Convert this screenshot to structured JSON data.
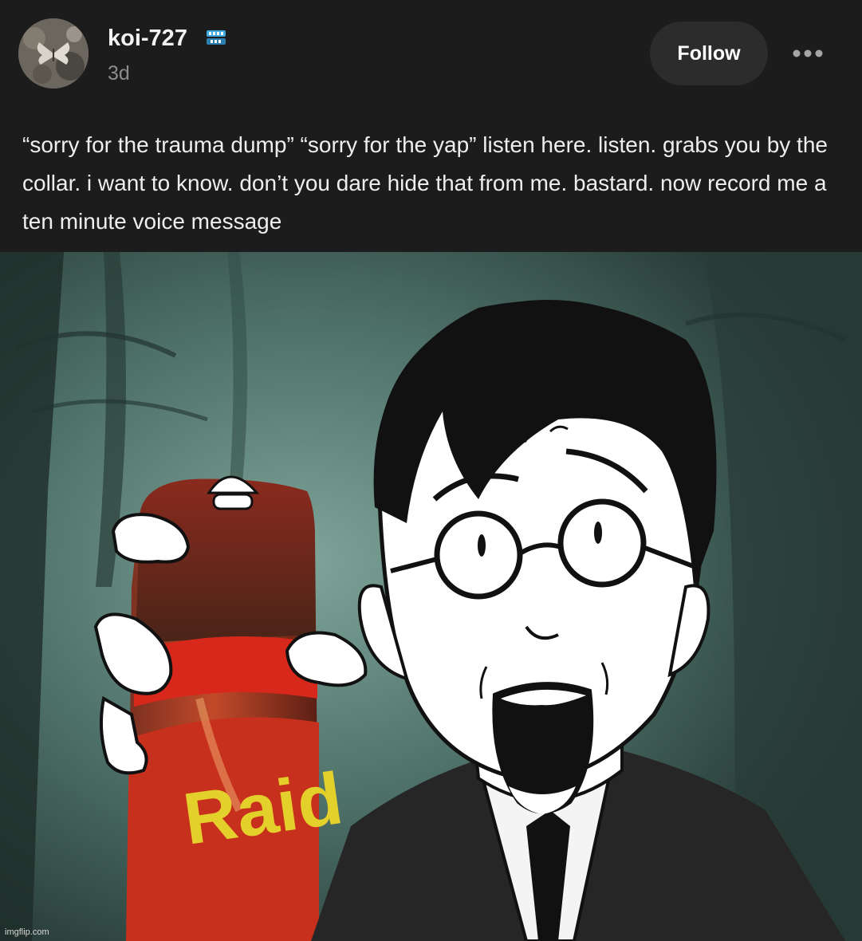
{
  "post": {
    "author": {
      "username": "koi-727",
      "badge_icon": "blue-teeth-icon",
      "timestamp": "3d"
    },
    "actions": {
      "follow_label": "Follow",
      "more_icon": "ellipsis-icon"
    },
    "body_text": "“sorry for the trauma dump” “sorry for the yap” listen here. listen. grabs you by the collar. i want to know. don’t you dare hide that from me. bastard. now record me a ten minute voice message",
    "image": {
      "can_label": "Raid",
      "watermark": "imgflip.com"
    }
  },
  "colors": {
    "background": "#1c1c1c",
    "button_bg": "#2c2c2c",
    "timestamp": "#8c8c8c",
    "badge_blue": "#3fa9e0"
  }
}
